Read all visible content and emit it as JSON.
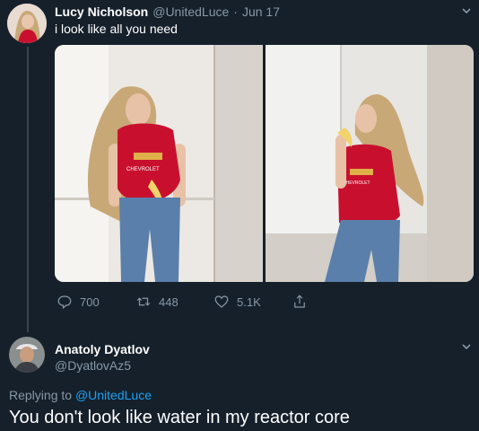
{
  "tweet": {
    "author_name": "Lucy Nicholson",
    "author_handle": "@UnitedLuce",
    "separator": "·",
    "date": "Jun 17",
    "text": "i look like all you need",
    "media": [
      {
        "shirt_text": "CHEVROLET"
      },
      {
        "shirt_text": "CHEVROLET"
      }
    ],
    "actions": {
      "replies": "700",
      "retweets": "448",
      "likes": "5.1K"
    }
  },
  "reply": {
    "author_name": "Anatoly Dyatlov",
    "author_handle": "@DyatlovAz5",
    "replying_prefix": "Replying to",
    "replying_handle": "@UnitedLuce",
    "text": "You don't look like water in my reactor core"
  },
  "colors": {
    "background": "#15202b",
    "secondary_text": "#8899a6",
    "link": "#1da1f2",
    "divider": "#38444d"
  },
  "icons": [
    "chevron-down-icon",
    "reply-icon",
    "retweet-icon",
    "like-icon",
    "share-icon"
  ]
}
